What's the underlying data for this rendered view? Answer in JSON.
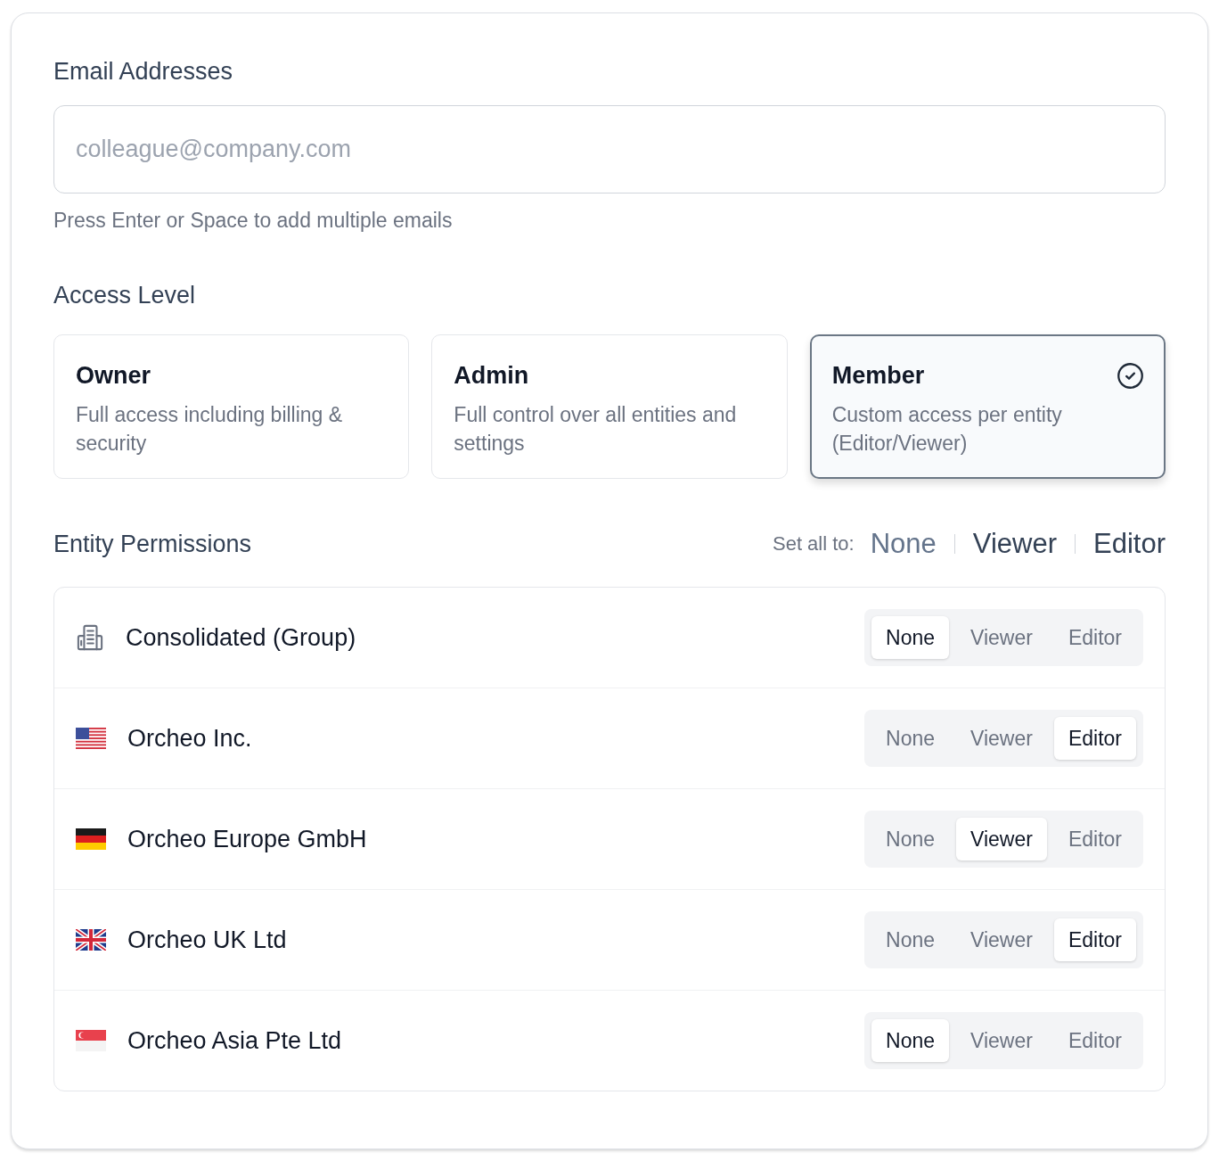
{
  "email": {
    "label": "Email Addresses",
    "placeholder": "colleague@company.com",
    "hint": "Press Enter or Space to add multiple emails"
  },
  "access": {
    "label": "Access Level",
    "levels": [
      {
        "title": "Owner",
        "description": "Full access including billing & security",
        "selected": false
      },
      {
        "title": "Admin",
        "description": "Full control over all entities and settings",
        "selected": false
      },
      {
        "title": "Member",
        "description": "Custom access per entity (Editor/Viewer)",
        "selected": true
      }
    ]
  },
  "permissions": {
    "label": "Entity Permissions",
    "set_all": {
      "label": "Set all to:",
      "options": [
        {
          "label": "None",
          "muted": true
        },
        {
          "label": "Viewer",
          "muted": false
        },
        {
          "label": "Editor",
          "muted": false
        }
      ]
    },
    "entities": [
      {
        "name": "Consolidated (Group)",
        "options": [
          {
            "label": "None",
            "selected": true
          },
          {
            "label": "Viewer",
            "selected": false
          },
          {
            "label": "Editor",
            "selected": false
          }
        ]
      },
      {
        "name": "Orcheo Inc.",
        "options": [
          {
            "label": "None",
            "selected": false
          },
          {
            "label": "Viewer",
            "selected": false
          },
          {
            "label": "Editor",
            "selected": true
          }
        ]
      },
      {
        "name": "Orcheo Europe GmbH",
        "options": [
          {
            "label": "None",
            "selected": false
          },
          {
            "label": "Viewer",
            "selected": true
          },
          {
            "label": "Editor",
            "selected": false
          }
        ]
      },
      {
        "name": "Orcheo UK Ltd",
        "options": [
          {
            "label": "None",
            "selected": false
          },
          {
            "label": "Viewer",
            "selected": false
          },
          {
            "label": "Editor",
            "selected": true
          }
        ]
      },
      {
        "name": "Orcheo Asia Pte Ltd",
        "options": [
          {
            "label": "None",
            "selected": true
          },
          {
            "label": "Viewer",
            "selected": false
          },
          {
            "label": "Editor",
            "selected": false
          }
        ]
      }
    ]
  }
}
